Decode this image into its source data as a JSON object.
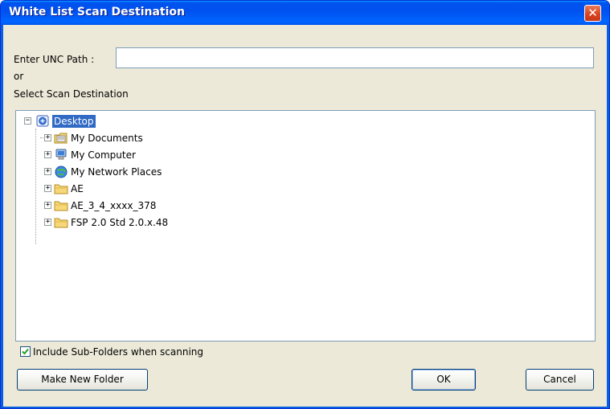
{
  "window": {
    "title": "White List Scan Destination",
    "close_glyph": "✕"
  },
  "unc": {
    "label": "Enter UNC Path :",
    "value": "",
    "placeholder": ""
  },
  "or_label": "or",
  "select_label": "Select Scan Destination",
  "tree": {
    "root": {
      "label": "Desktop",
      "icon": "desktop-icon",
      "expanded": true,
      "selected": true
    },
    "children": [
      {
        "label": "My Documents",
        "icon": "my-documents-icon"
      },
      {
        "label": "My Computer",
        "icon": "my-computer-icon"
      },
      {
        "label": "My Network Places",
        "icon": "network-places-icon"
      },
      {
        "label": "AE",
        "icon": "folder-icon"
      },
      {
        "label": "AE_3_4_xxxx_378",
        "icon": "folder-icon"
      },
      {
        "label": "FSP 2.0 Std 2.0.x.48",
        "icon": "folder-icon"
      }
    ]
  },
  "include_subfolders": {
    "label": "Include Sub-Folders when scanning",
    "checked": true
  },
  "buttons": {
    "make_new_folder": "Make New Folder",
    "ok": "OK",
    "cancel": "Cancel"
  },
  "colors": {
    "title_bar": "#0053ee",
    "selection": "#316ac5",
    "dialog_bg": "#ece9d8",
    "close_button": "#d8411b"
  }
}
